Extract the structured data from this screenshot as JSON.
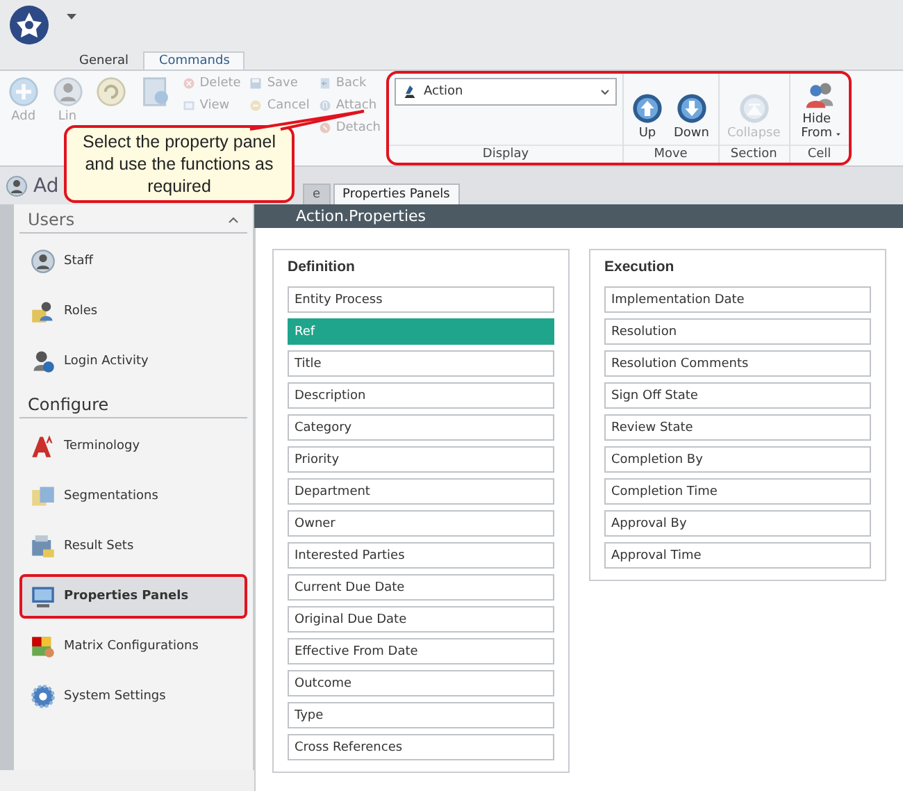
{
  "ribbon_tabs": [
    {
      "label": "General",
      "selected": false
    },
    {
      "label": "Commands",
      "selected": true
    }
  ],
  "ribbon_left": {
    "large_buttons": [
      {
        "label": "Add"
      },
      {
        "label": "Lin"
      }
    ],
    "small_buttons": [
      {
        "label": "Delete"
      },
      {
        "label": "View"
      },
      {
        "label": "Save"
      },
      {
        "label": "Cancel"
      },
      {
        "label": "Back"
      },
      {
        "label": "Attach"
      },
      {
        "label": "Detach"
      }
    ]
  },
  "ribbon_groups": [
    {
      "label": "Display",
      "kind": "dropdown",
      "value": "Action"
    },
    {
      "label": "Move",
      "kind": "buttons",
      "buttons": [
        {
          "label": "Up",
          "disabled": false
        },
        {
          "label": "Down",
          "disabled": false
        }
      ]
    },
    {
      "label": "Section",
      "kind": "buttons",
      "buttons": [
        {
          "label": "Collapse",
          "disabled": true
        }
      ]
    },
    {
      "label": "Cell",
      "kind": "buttons",
      "buttons": [
        {
          "label": "Hide From",
          "disabled": false,
          "menu": true
        }
      ]
    }
  ],
  "callout": "Select the property panel and use the functions as required",
  "module_title": "Ad",
  "doc_tabs": [
    {
      "label": "e",
      "selected": false
    },
    {
      "label": "Properties Panels",
      "selected": true
    }
  ],
  "sidebar": {
    "sections": [
      {
        "title": "Users",
        "collapsible": true,
        "items": [
          {
            "label": "Staff",
            "selected": false
          },
          {
            "label": "Roles",
            "selected": false
          },
          {
            "label": "Login Activity",
            "selected": false
          }
        ]
      },
      {
        "title": "Configure",
        "collapsible": false,
        "items": [
          {
            "label": "Terminology",
            "selected": false
          },
          {
            "label": "Segmentations",
            "selected": false
          },
          {
            "label": "Result Sets",
            "selected": false
          },
          {
            "label": "Properties Panels",
            "selected": true
          },
          {
            "label": "Matrix Configurations",
            "selected": false
          },
          {
            "label": "System Settings",
            "selected": false
          }
        ]
      }
    ]
  },
  "content_title": "Action.Properties",
  "panels": [
    {
      "title": "Definition",
      "fields": [
        {
          "label": "Entity Process",
          "selected": false
        },
        {
          "label": "Ref",
          "selected": true
        },
        {
          "label": "Title",
          "selected": false
        },
        {
          "label": "Description",
          "selected": false
        },
        {
          "label": "Category",
          "selected": false
        },
        {
          "label": "Priority",
          "selected": false
        },
        {
          "label": "Department",
          "selected": false
        },
        {
          "label": "Owner",
          "selected": false
        },
        {
          "label": "Interested Parties",
          "selected": false
        },
        {
          "label": "Current Due Date",
          "selected": false
        },
        {
          "label": "Original Due Date",
          "selected": false
        },
        {
          "label": "Effective From Date",
          "selected": false
        },
        {
          "label": "Outcome",
          "selected": false
        },
        {
          "label": "Type",
          "selected": false
        },
        {
          "label": "Cross References",
          "selected": false
        }
      ]
    },
    {
      "title": "Execution",
      "fields": [
        {
          "label": "Implementation Date",
          "selected": false
        },
        {
          "label": "Resolution",
          "selected": false
        },
        {
          "label": "Resolution Comments",
          "selected": false
        },
        {
          "label": "Sign Off State",
          "selected": false
        },
        {
          "label": "Review State",
          "selected": false
        },
        {
          "label": "Completion By",
          "selected": false
        },
        {
          "label": "Completion Time",
          "selected": false
        },
        {
          "label": "Approval By",
          "selected": false
        },
        {
          "label": "Approval Time",
          "selected": false
        }
      ]
    }
  ]
}
